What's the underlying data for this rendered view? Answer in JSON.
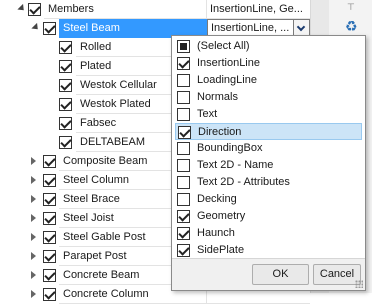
{
  "tree": {
    "root": {
      "label": "Members",
      "value": "InsertionLine, Ge..."
    },
    "selected": {
      "label": "Steel Beam",
      "value": "InsertionLine, ..."
    },
    "children": [
      "Rolled",
      "Plated",
      "Westok Cellular",
      "Westok Plated",
      "Fabsec",
      "DELTABEAM"
    ],
    "siblings": [
      "Composite Beam",
      "Steel Column",
      "Steel Brace",
      "Steel Joist",
      "Steel Gable Post",
      "Parapet Post",
      "Concrete Beam",
      "Concrete Column"
    ]
  },
  "dropdown": {
    "options": [
      {
        "label": "(Select All)",
        "state": "indeterminate"
      },
      {
        "label": "InsertionLine",
        "state": "checked"
      },
      {
        "label": "LoadingLine",
        "state": "unchecked"
      },
      {
        "label": "Normals",
        "state": "unchecked"
      },
      {
        "label": "Text",
        "state": "unchecked"
      },
      {
        "label": "Direction",
        "state": "checked",
        "highlighted": true
      },
      {
        "label": "BoundingBox",
        "state": "unchecked"
      },
      {
        "label": "Text 2D - Name",
        "state": "unchecked"
      },
      {
        "label": "Text 2D - Attributes",
        "state": "unchecked"
      },
      {
        "label": "Decking",
        "state": "unchecked"
      },
      {
        "label": "Geometry",
        "state": "checked"
      },
      {
        "label": "Haunch",
        "state": "checked"
      },
      {
        "label": "SidePlate",
        "state": "checked"
      }
    ],
    "ok_label": "OK",
    "cancel_label": "Cancel"
  },
  "toolbar": {
    "top_icon": "pin-icon",
    "second_icon": "refresh-icon"
  },
  "colors": {
    "selection": "#3399ff",
    "hover": "#cce4f7"
  }
}
